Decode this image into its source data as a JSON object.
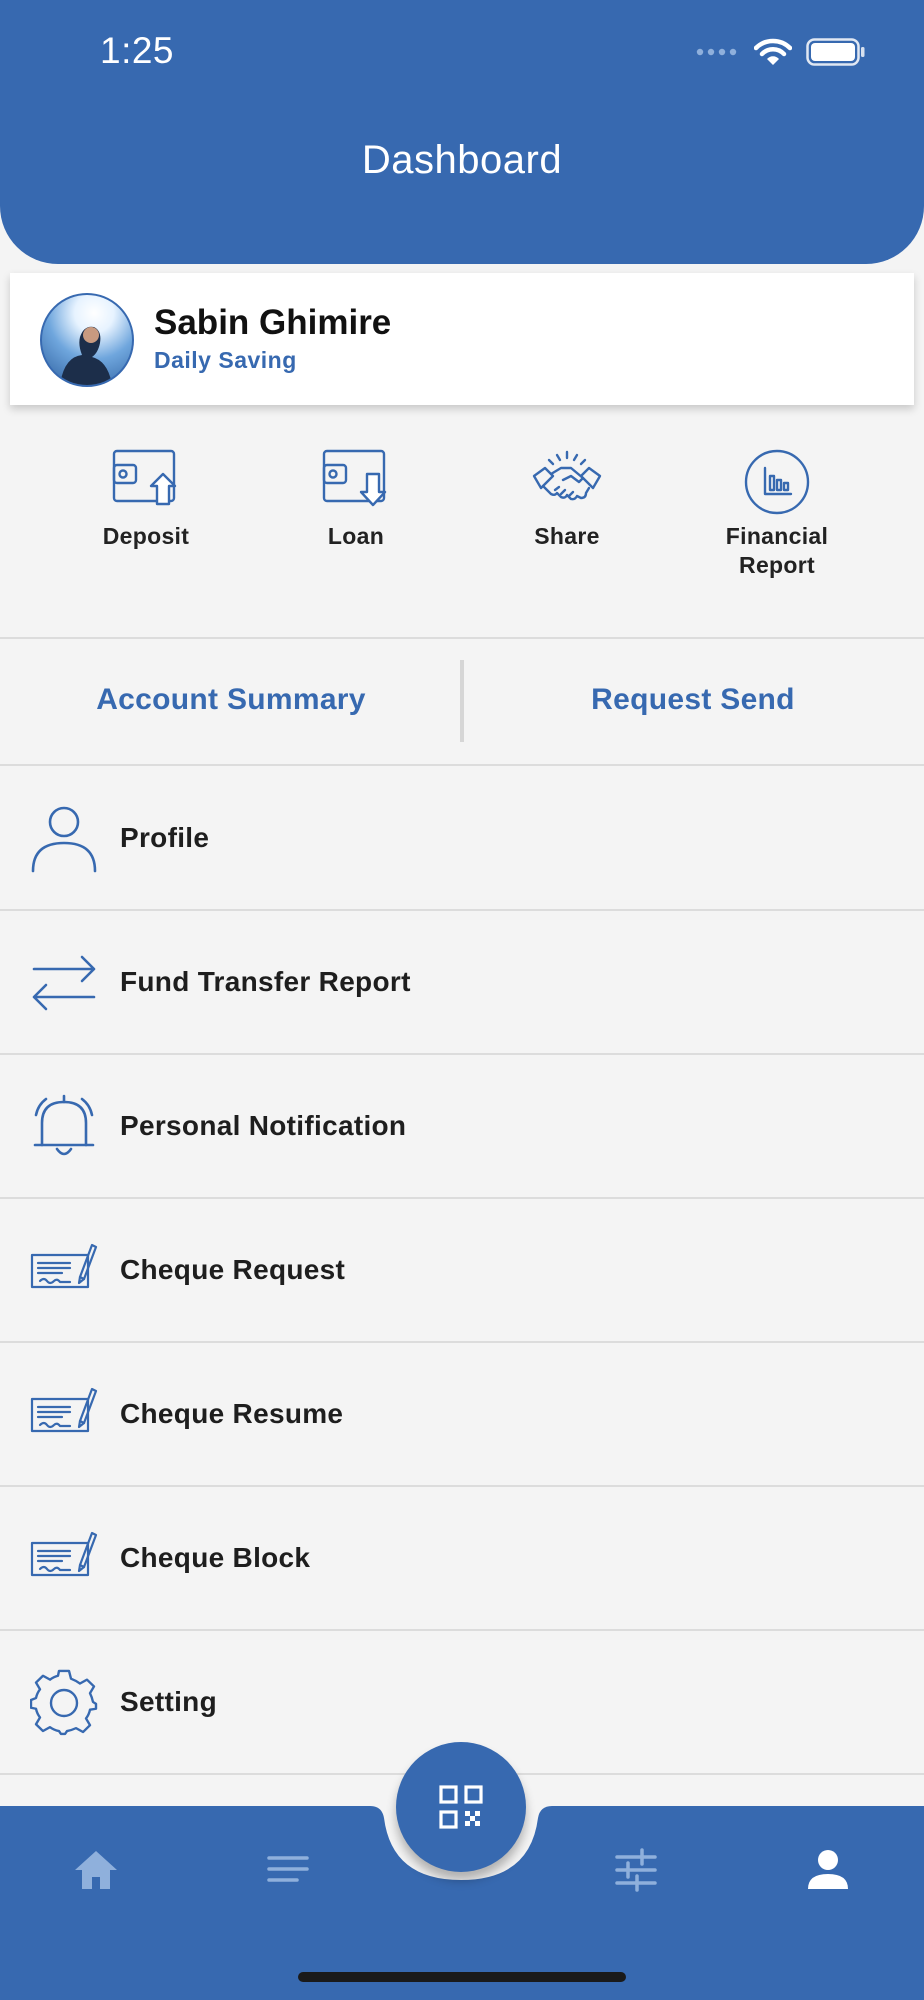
{
  "status_bar": {
    "time": "1:25"
  },
  "header": {
    "title": "Dashboard"
  },
  "profile": {
    "name": "Sabin Ghimire",
    "account_type": "Daily Saving"
  },
  "quick_actions": [
    {
      "label": "Deposit",
      "icon": "wallet-upload-icon"
    },
    {
      "label": "Loan",
      "icon": "wallet-download-icon"
    },
    {
      "label": "Share",
      "icon": "handshake-icon"
    },
    {
      "label": "Financial\nReport",
      "icon": "bar-chart-icon"
    }
  ],
  "tabs": [
    {
      "label": "Account Summary"
    },
    {
      "label": "Request Send"
    }
  ],
  "menu": [
    {
      "label": "Profile",
      "icon": "user-icon"
    },
    {
      "label": "Fund Transfer Report",
      "icon": "transfer-arrows-icon"
    },
    {
      "label": "Personal Notification",
      "icon": "bell-icon"
    },
    {
      "label": "Cheque Request",
      "icon": "cheque-icon"
    },
    {
      "label": "Cheque Resume",
      "icon": "cheque-icon"
    },
    {
      "label": "Cheque Block",
      "icon": "cheque-icon"
    },
    {
      "label": "Setting",
      "icon": "gear-icon"
    }
  ],
  "tab_bar": {
    "items": [
      {
        "icon": "home-icon"
      },
      {
        "icon": "menu-lines-icon"
      },
      {
        "icon": "qr-code-icon"
      },
      {
        "icon": "sliders-icon"
      },
      {
        "icon": "person-icon"
      }
    ]
  },
  "colors": {
    "primary": "#3769b0",
    "background": "#f4f4f4",
    "card": "#ffffff",
    "text": "#1e1e1e"
  }
}
